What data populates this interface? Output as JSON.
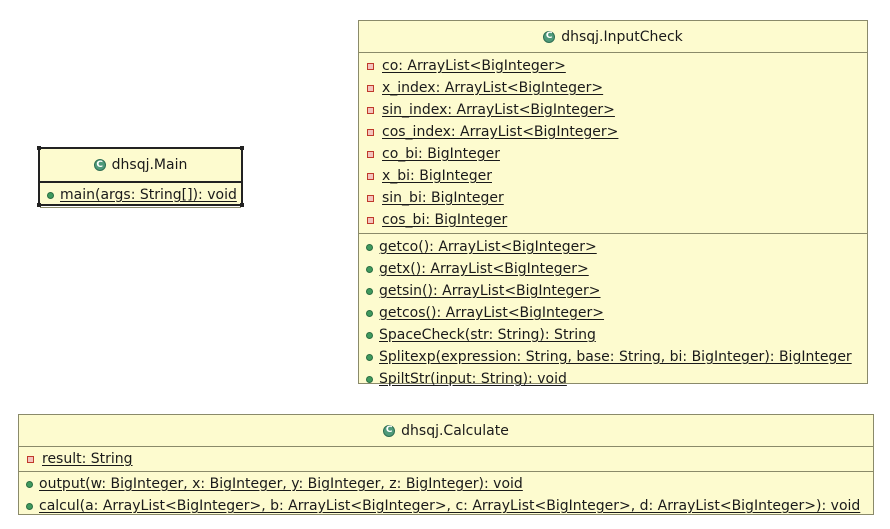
{
  "classes": {
    "main": {
      "title": "dhsqj.Main",
      "methods": [
        {
          "text": "main(args: String[]): void"
        }
      ]
    },
    "inputcheck": {
      "title": "dhsqj.InputCheck",
      "fields": [
        {
          "text": "co: ArrayList<BigInteger>"
        },
        {
          "text": "x_index: ArrayList<BigInteger>"
        },
        {
          "text": "sin_index: ArrayList<BigInteger>"
        },
        {
          "text": "cos_index: ArrayList<BigInteger>"
        },
        {
          "text": "co_bi: BigInteger"
        },
        {
          "text": "x_bi: BigInteger"
        },
        {
          "text": "sin_bi: BigInteger"
        },
        {
          "text": "cos_bi: BigInteger"
        }
      ],
      "methods": [
        {
          "text": "getco(): ArrayList<BigInteger>"
        },
        {
          "text": "getx(): ArrayList<BigInteger>"
        },
        {
          "text": "getsin(): ArrayList<BigInteger>"
        },
        {
          "text": "getcos(): ArrayList<BigInteger>"
        },
        {
          "text": "SpaceCheck(str: String): String"
        },
        {
          "text": "Splitexp(expression: String, base: String, bi: BigInteger): BigInteger"
        },
        {
          "text": "SpiltStr(input: String): void"
        }
      ]
    },
    "calculate": {
      "title": "dhsqj.Calculate",
      "fields": [
        {
          "text": "result: String"
        }
      ],
      "methods": [
        {
          "text": "output(w: BigInteger, x: BigInteger, y: BigInteger, z: BigInteger): void"
        },
        {
          "text": "calcul(a: ArrayList<BigInteger>, b: ArrayList<BigInteger>, c: ArrayList<BigInteger>, d: ArrayList<BigInteger>): void"
        }
      ]
    }
  },
  "icons": {
    "class_glyph": "C",
    "class_icon": "class-icon",
    "private_icon": "private-field-icon",
    "public_icon": "public-method-icon"
  },
  "colors": {
    "box_fill": "#fdfbcf",
    "border": "#8a8a6a",
    "private": "#c0392b",
    "public": "#3f9a5e"
  }
}
